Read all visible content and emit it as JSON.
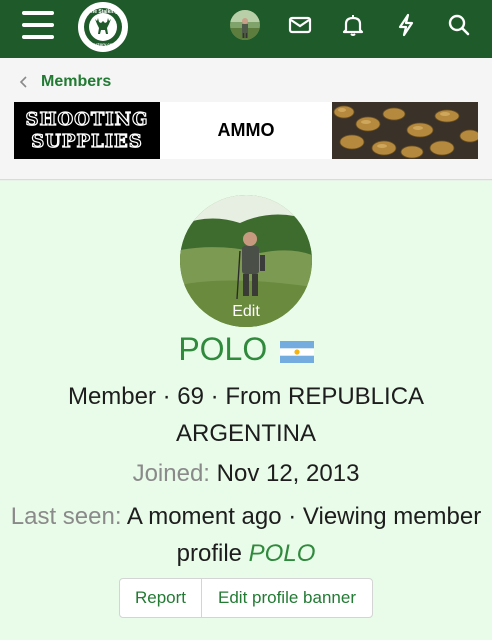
{
  "topbar": {
    "logo_text": "The Stalking Directory.co.uk",
    "icons": [
      "menu-icon",
      "envelope-icon",
      "bell-icon",
      "bolt-icon",
      "search-icon"
    ],
    "bar_color": "#1e5a2a"
  },
  "breadcrumb": {
    "label": "Members"
  },
  "banner": {
    "brand_line1": "SHOOTING",
    "brand_line2": "SUPPLIES",
    "product": "AMMO"
  },
  "profile": {
    "avatar_edit_label": "Edit",
    "username": "POLO",
    "flag": "argentina-flag",
    "member_line": "Member · 69 · From REPUBLICA ARGENTINA",
    "joined_label": "Joined:",
    "joined_value": "Nov 12, 2013",
    "last_seen_label": "Last seen:",
    "last_seen_value": "A moment ago · Viewing member profile",
    "last_seen_link": "POLO",
    "accent_color": "#2f8a3c"
  },
  "actions": {
    "report_label": "Report",
    "edit_banner_label": "Edit profile banner"
  }
}
